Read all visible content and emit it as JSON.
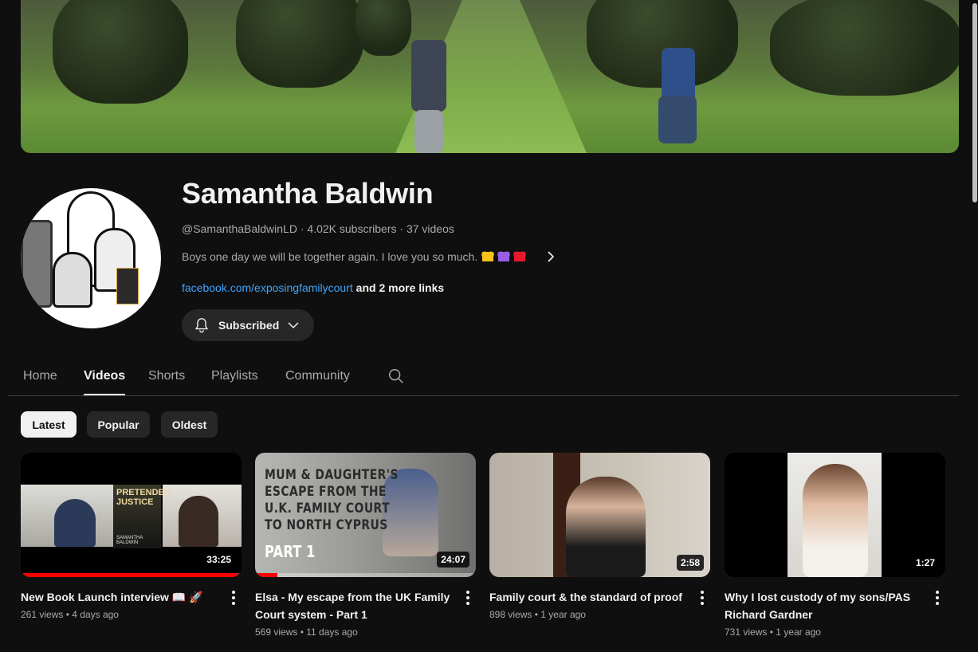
{
  "channel": {
    "name": "Samantha Baldwin",
    "handle": "@SamanthaBaldwinLD",
    "subscribers": "4.02K subscribers",
    "videos": "37 videos",
    "separator": "·",
    "description": "Boys one day we will be together again. I love you so much.",
    "hearts": [
      {
        "name": "yellow-heart-icon",
        "color": "#f6c21b"
      },
      {
        "name": "purple-heart-icon",
        "color": "#9b5de5"
      },
      {
        "name": "red-heart-icon",
        "color": "#e8192c"
      }
    ],
    "link": "facebook.com/exposingfamilycourt",
    "more_links": "and 2 more links",
    "subscribe_label": "Subscribed"
  },
  "tabs": [
    {
      "label": "Home",
      "active": false
    },
    {
      "label": "Videos",
      "active": true
    },
    {
      "label": "Shorts",
      "active": false
    },
    {
      "label": "Playlists",
      "active": false
    },
    {
      "label": "Community",
      "active": false
    }
  ],
  "chips": [
    {
      "label": "Latest",
      "active": true
    },
    {
      "label": "Popular",
      "active": false
    },
    {
      "label": "Oldest",
      "active": false
    }
  ],
  "videos": [
    {
      "title": "New Book Launch interview 📖 🚀",
      "views": "261 views",
      "age": "4 days ago",
      "duration": "33:25",
      "watched_fraction": 0.98,
      "book_title": "PRETENDED JUSTICE",
      "book_author": "SAMANTHA BALDWIN"
    },
    {
      "title": "Elsa - My escape from the UK Family Court system - Part 1",
      "views": "569 views",
      "age": "11 days ago",
      "duration": "24:07",
      "watched_fraction": 0.1,
      "overlay_lines": [
        "MUM & DAUGHTER'S",
        "ESCAPE FROM THE",
        "U.K. FAMILY COURT",
        "TO NORTH CYPRUS"
      ],
      "overlay_part": "PART 1"
    },
    {
      "title": "Family court & the standard of proof",
      "views": "898 views",
      "age": "1 year ago",
      "duration": "2:58"
    },
    {
      "title": "Why I lost custody of my sons/PAS Richard Gardner",
      "views": "731 views",
      "age": "1 year ago",
      "duration": "1:27"
    }
  ],
  "stats_separator": "•"
}
